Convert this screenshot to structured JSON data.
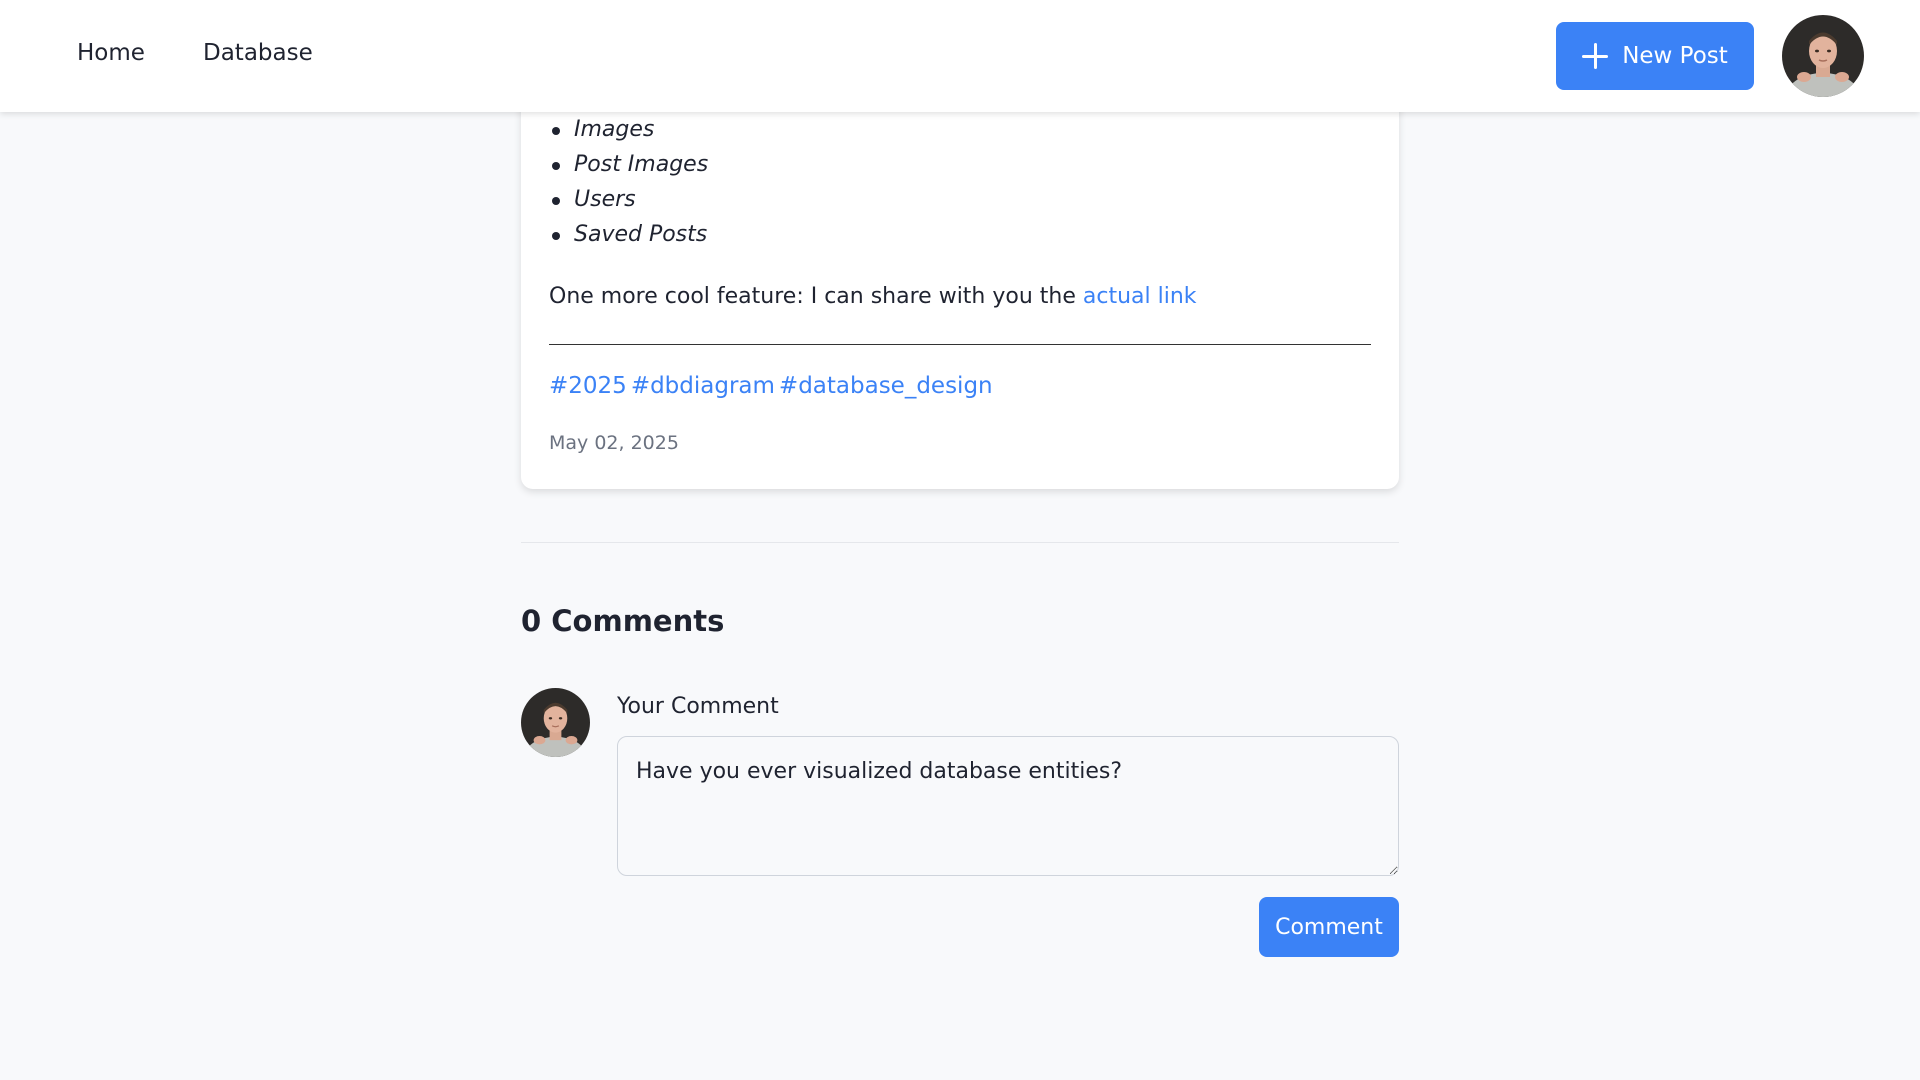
{
  "nav": {
    "items": [
      {
        "label": "Home"
      },
      {
        "label": "Database"
      }
    ],
    "new_post_label": "New Post"
  },
  "post": {
    "list_items": [
      "Images",
      "Post Images",
      "Users",
      "Saved Posts"
    ],
    "paragraph_text": "One more cool feature: I can share with you the ",
    "link_text": "actual link",
    "tags": [
      "#2025",
      "#dbdiagram",
      "#database_design"
    ],
    "date": "May 02, 2025"
  },
  "comments": {
    "heading": "0 Comments",
    "label": "Your Comment",
    "textarea_value": "Have you ever visualized database entities?",
    "submit_label": "Comment"
  },
  "colors": {
    "accent": "#3b82f6",
    "background": "#f8f9fb",
    "text": "#1f2330",
    "muted": "#6b7280"
  },
  "icons": [
    "plus-icon",
    "user-avatar"
  ]
}
